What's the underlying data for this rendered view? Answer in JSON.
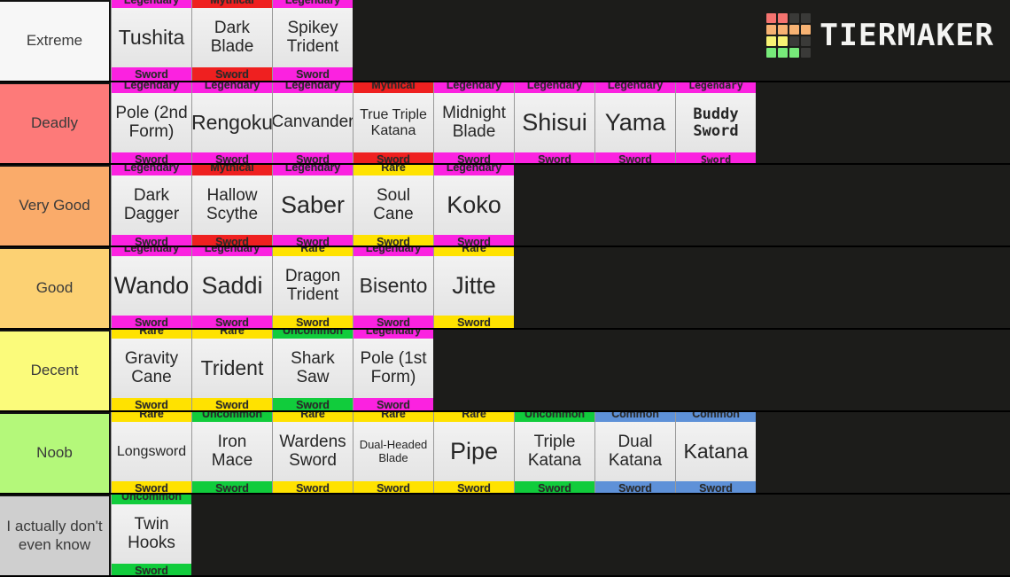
{
  "app": {
    "brand": "TIERMAKER",
    "background_color": "#1c1c1a",
    "logo_colors": [
      "#f4736f",
      "#f4736f",
      "#3a3a38",
      "#3a3a38",
      "#f7b273",
      "#f7b273",
      "#f7b273",
      "#f7b273",
      "#f7f274",
      "#f7f274",
      "#3a3a38",
      "#3a3a38",
      "#77ea7a",
      "#77ea7a",
      "#77ea7a",
      "#3a3a38"
    ]
  },
  "rarity_colors": {
    "Mythical": "#ef2020",
    "Legendary": "#fb22e0",
    "Rare": "#ffe200",
    "Uncommon": "#11cc3c",
    "Common": "#5e91d8"
  },
  "tiers": [
    {
      "label": "Extreme",
      "color": "#f7f7f7",
      "items": [
        {
          "name": "Tushita",
          "lines": [
            "Tushita"
          ],
          "rarity": "Legendary",
          "type": "Sword",
          "size": "s-lg"
        },
        {
          "name": "Dark Blade",
          "lines": [
            "Dark",
            "Blade"
          ],
          "rarity": "Mythical",
          "type": "Sword",
          "size": "s-md"
        },
        {
          "name": "Spikey Trident",
          "lines": [
            "Spikey",
            "Trident"
          ],
          "rarity": "Legendary",
          "type": "Sword",
          "size": "s-md"
        }
      ]
    },
    {
      "label": "Deadly",
      "color": "#fd7a79",
      "items": [
        {
          "name": "Pole (2nd Form)",
          "lines": [
            "Pole (2nd",
            "Form)"
          ],
          "rarity": "Legendary",
          "type": "Sword",
          "size": "s-md"
        },
        {
          "name": "Rengoku",
          "lines": [
            "Rengoku"
          ],
          "rarity": "Legendary",
          "type": "Sword",
          "size": "s-lg"
        },
        {
          "name": "Canvander",
          "lines": [
            "Canvander"
          ],
          "rarity": "Legendary",
          "type": "Sword",
          "size": "s-md"
        },
        {
          "name": "True Triple Katana",
          "lines": [
            "True Triple",
            "Katana"
          ],
          "rarity": "Mythical",
          "type": "Sword",
          "size": "s-sm"
        },
        {
          "name": "Midnight Blade",
          "lines": [
            "Midnight",
            "Blade"
          ],
          "rarity": "Legendary",
          "type": "Sword",
          "size": "s-md"
        },
        {
          "name": "Shisui",
          "lines": [
            "Shisui"
          ],
          "rarity": "Legendary",
          "type": "Sword",
          "size": "s-xl"
        },
        {
          "name": "Yama",
          "lines": [
            "Yama"
          ],
          "rarity": "Legendary",
          "type": "Sword",
          "size": "s-xl"
        },
        {
          "name": "Buddy Sword",
          "lines": [
            "Buddy",
            "Sword"
          ],
          "rarity": "Legendary",
          "type": "Sword",
          "size": "s-md",
          "font": "pixel"
        }
      ]
    },
    {
      "label": "Very Good",
      "color": "#faab6a",
      "items": [
        {
          "name": "Dark Dagger",
          "lines": [
            "Dark",
            "Dagger"
          ],
          "rarity": "Legendary",
          "type": "Sword",
          "size": "s-md"
        },
        {
          "name": "Hallow Scythe",
          "lines": [
            "Hallow",
            "Scythe"
          ],
          "rarity": "Mythical",
          "type": "Sword",
          "size": "s-md"
        },
        {
          "name": "Saber",
          "lines": [
            "Saber"
          ],
          "rarity": "Legendary",
          "type": "Sword",
          "size": "s-xl"
        },
        {
          "name": "Soul Cane",
          "lines": [
            "Soul",
            "Cane"
          ],
          "rarity": "Rare",
          "type": "Sword",
          "size": "s-md"
        },
        {
          "name": "Koko",
          "lines": [
            "Koko"
          ],
          "rarity": "Legendary",
          "type": "Sword",
          "size": "s-xl"
        }
      ]
    },
    {
      "label": "Good",
      "color": "#fcd173",
      "items": [
        {
          "name": "Wando",
          "lines": [
            "Wando"
          ],
          "rarity": "Legendary",
          "type": "Sword",
          "size": "s-xl"
        },
        {
          "name": "Saddi",
          "lines": [
            "Saddi"
          ],
          "rarity": "Legendary",
          "type": "Sword",
          "size": "s-xl"
        },
        {
          "name": "Dragon Trident",
          "lines": [
            "Dragon",
            "Trident"
          ],
          "rarity": "Rare",
          "type": "Sword",
          "size": "s-md"
        },
        {
          "name": "Bisento",
          "lines": [
            "Bisento"
          ],
          "rarity": "Legendary",
          "type": "Sword",
          "size": "s-lg"
        },
        {
          "name": "Jitte",
          "lines": [
            "Jitte"
          ],
          "rarity": "Rare",
          "type": "Sword",
          "size": "s-xl"
        }
      ]
    },
    {
      "label": "Decent",
      "color": "#fbfb7b",
      "items": [
        {
          "name": "Gravity Cane",
          "lines": [
            "Gravity",
            "Cane"
          ],
          "rarity": "Rare",
          "type": "Sword",
          "size": "s-md"
        },
        {
          "name": "Trident",
          "lines": [
            "Trident"
          ],
          "rarity": "Rare",
          "type": "Sword",
          "size": "s-lg"
        },
        {
          "name": "Shark Saw",
          "lines": [
            "Shark",
            "Saw"
          ],
          "rarity": "Uncommon",
          "type": "Sword",
          "size": "s-md"
        },
        {
          "name": "Pole (1st Form)",
          "lines": [
            "Pole (1st",
            "Form)"
          ],
          "rarity": "Legendary",
          "type": "Sword",
          "size": "s-md"
        }
      ]
    },
    {
      "label": "Noob",
      "color": "#b4f87a",
      "items": [
        {
          "name": "Longsword",
          "lines": [
            "Longsword"
          ],
          "rarity": "Rare",
          "type": "Sword",
          "size": "s-sm"
        },
        {
          "name": "Iron Mace",
          "lines": [
            "Iron",
            "Mace"
          ],
          "rarity": "Uncommon",
          "type": "Sword",
          "size": "s-md"
        },
        {
          "name": "Wardens Sword",
          "lines": [
            "Wardens",
            "Sword"
          ],
          "rarity": "Rare",
          "type": "Sword",
          "size": "s-md"
        },
        {
          "name": "Dual-Headed Blade",
          "lines": [
            "Dual-Headed",
            "Blade"
          ],
          "rarity": "Rare",
          "type": "Sword",
          "size": "s-xs"
        },
        {
          "name": "Pipe",
          "lines": [
            "Pipe"
          ],
          "rarity": "Rare",
          "type": "Sword",
          "size": "s-xl"
        },
        {
          "name": "Triple Katana",
          "lines": [
            "Triple",
            "Katana"
          ],
          "rarity": "Uncommon",
          "type": "Sword",
          "size": "s-md"
        },
        {
          "name": "Dual Katana",
          "lines": [
            "Dual",
            "Katana"
          ],
          "rarity": "Common",
          "type": "Sword",
          "size": "s-md"
        },
        {
          "name": "Katana",
          "lines": [
            "Katana"
          ],
          "rarity": "Common",
          "type": "Sword",
          "size": "s-lg"
        }
      ]
    },
    {
      "label": "I actually don't even know",
      "color": "#cfcfcf",
      "items": [
        {
          "name": "Twin Hooks",
          "lines": [
            "Twin",
            "Hooks"
          ],
          "rarity": "Uncommon",
          "type": "Sword",
          "size": "s-md"
        }
      ]
    }
  ]
}
